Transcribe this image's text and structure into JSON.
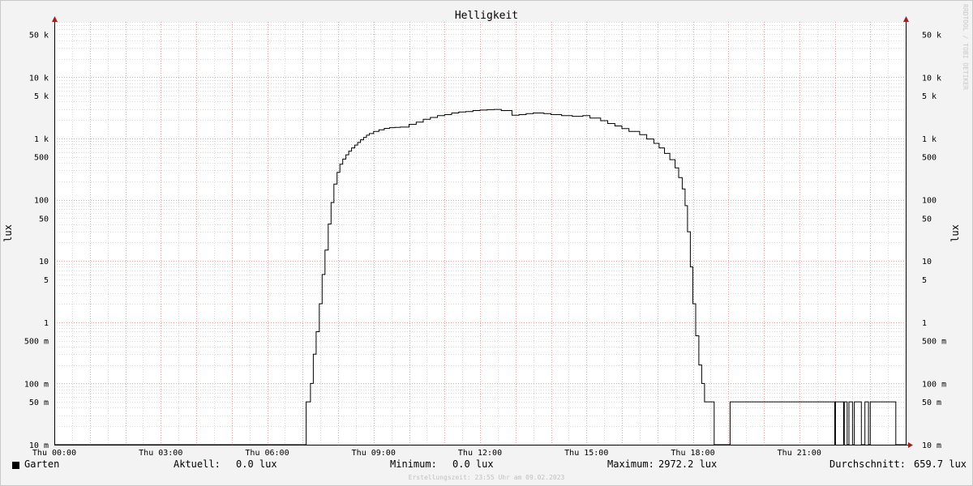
{
  "chart_data": {
    "type": "line",
    "title": "Helligkeit",
    "ylabel": "lux",
    "ylabel_right": "lux",
    "yscale": "log",
    "ylim": [
      0.01,
      80000
    ],
    "y_ticks": [
      {
        "v": 50000,
        "label": "50 k"
      },
      {
        "v": 10000,
        "label": "10 k"
      },
      {
        "v": 5000,
        "label": "5 k"
      },
      {
        "v": 1000,
        "label": "1 k"
      },
      {
        "v": 500,
        "label": "500"
      },
      {
        "v": 100,
        "label": "100"
      },
      {
        "v": 50,
        "label": "50"
      },
      {
        "v": 10,
        "label": "10"
      },
      {
        "v": 5,
        "label": "5"
      },
      {
        "v": 1,
        "label": "1"
      },
      {
        "v": 0.5,
        "label": "500 m"
      },
      {
        "v": 0.1,
        "label": "100 m"
      },
      {
        "v": 0.05,
        "label": "50 m"
      },
      {
        "v": 0.01,
        "label": "10 m"
      }
    ],
    "x_unit": "hours",
    "xlim": [
      0,
      24
    ],
    "x_ticks": [
      {
        "v": 0,
        "label": "Thu 00:00"
      },
      {
        "v": 3,
        "label": "Thu 03:00"
      },
      {
        "v": 6,
        "label": "Thu 06:00"
      },
      {
        "v": 9,
        "label": "Thu 09:00"
      },
      {
        "v": 12,
        "label": "Thu 12:00"
      },
      {
        "v": 15,
        "label": "Thu 15:00"
      },
      {
        "v": 18,
        "label": "Thu 18:00"
      },
      {
        "v": 21,
        "label": "Thu 21:00"
      }
    ],
    "grid": true,
    "series": [
      {
        "name": "Garten",
        "color": "#000000",
        "x": [
          0,
          7.08,
          7.1,
          7.22,
          7.3,
          7.38,
          7.47,
          7.55,
          7.63,
          7.72,
          7.8,
          7.88,
          7.97,
          8.05,
          8.13,
          8.22,
          8.3,
          8.38,
          8.47,
          8.55,
          8.63,
          8.72,
          8.8,
          8.88,
          9.0,
          9.15,
          9.3,
          9.45,
          9.6,
          9.75,
          10.0,
          10.2,
          10.4,
          10.6,
          10.8,
          11.0,
          11.2,
          11.4,
          11.6,
          11.8,
          12.0,
          12.2,
          12.4,
          12.6,
          12.9,
          13.1,
          13.3,
          13.5,
          13.8,
          14.0,
          14.3,
          14.6,
          14.9,
          15.1,
          15.4,
          15.6,
          15.8,
          16.0,
          16.2,
          16.5,
          16.7,
          16.9,
          17.05,
          17.2,
          17.35,
          17.5,
          17.6,
          17.7,
          17.78,
          17.85,
          17.93,
          18.0,
          18.08,
          18.17,
          18.25,
          18.33,
          18.42,
          18.5,
          18.6,
          18.8,
          19.0,
          19.05,
          19.08,
          19.3,
          21.0,
          22.0,
          22.02,
          22.25,
          22.27,
          22.35,
          22.4,
          22.5,
          22.55,
          22.75,
          22.85,
          22.95,
          23.0,
          23.7,
          23.72
        ],
        "y": [
          0.01,
          0.01,
          0.05,
          0.1,
          0.3,
          0.7,
          2,
          6,
          15,
          40,
          90,
          180,
          280,
          380,
          460,
          540,
          620,
          700,
          780,
          860,
          950,
          1040,
          1130,
          1200,
          1300,
          1380,
          1460,
          1500,
          1520,
          1530,
          1700,
          1850,
          2050,
          2200,
          2350,
          2450,
          2600,
          2700,
          2750,
          2850,
          2900,
          2950,
          2972.2,
          2850,
          2400,
          2450,
          2550,
          2600,
          2550,
          2450,
          2350,
          2300,
          2350,
          2150,
          1950,
          1750,
          1600,
          1450,
          1300,
          1150,
          980,
          830,
          700,
          570,
          450,
          330,
          230,
          150,
          80,
          30,
          8,
          2,
          0.6,
          0.2,
          0.1,
          0.05,
          0.05,
          0.05,
          0.01,
          0.01,
          0.01,
          0.05,
          0.05,
          0.05,
          0.05,
          0.01,
          0.05,
          0.01,
          0.05,
          0.01,
          0.05,
          0.01,
          0.05,
          0.01,
          0.05,
          0.01,
          0.05,
          0.05,
          0.01
        ]
      }
    ]
  },
  "watermark": "RRDTOOL / TOBI OETIKER",
  "legend": {
    "series_name": "Garten",
    "aktuell_label": "Aktuell:",
    "aktuell_value": "0.0 lux",
    "minimum_label": "Minimum:",
    "minimum_value": "0.0 lux",
    "maximum_label": "Maximum:",
    "maximum_value": "2972.2 lux",
    "durchschnitt_label": "Durchschnitt:",
    "durchschnitt_value": "659.7 lux"
  },
  "footer": "Erstellungszeit: 23:55 Uhr am 09.02.2023"
}
